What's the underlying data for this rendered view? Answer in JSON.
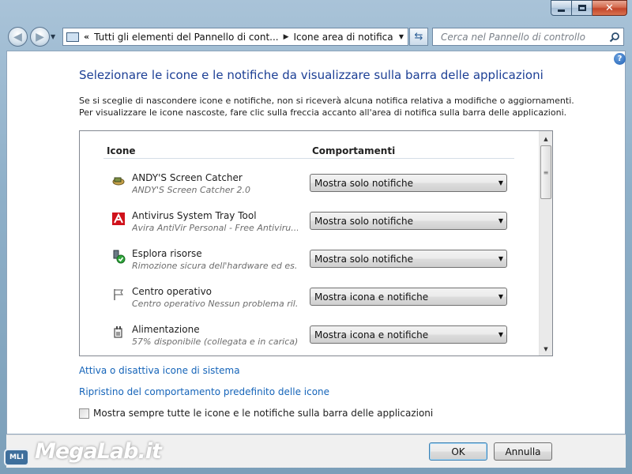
{
  "window": {
    "controls": {
      "minimize_icon": "minimize-icon",
      "maximize_icon": "maximize-icon",
      "close_icon": "close-icon"
    }
  },
  "navbar": {
    "breadcrumb_parent": "Tutti gli elementi del Pannello di cont...",
    "breadcrumb_current": "Icone area di notifica",
    "search_placeholder": "Cerca nel Pannello di controllo"
  },
  "main": {
    "title": "Selezionare le icone e le notifiche da visualizzare sulla barra delle applicazioni",
    "description_line1": "Se si sceglie di nascondere icone e notifiche, non si riceverà alcuna notifica relativa a modifiche o aggiornamenti.",
    "description_line2": "Per visualizzare le icone nascoste, fare clic sulla freccia accanto all'area di notifica sulla barra delle applicazioni.",
    "col_icons": "Icone",
    "col_behaviors": "Comportamenti",
    "rows": [
      {
        "name": "ANDY'S Screen Catcher",
        "sub": "ANDY'S Screen Catcher 2.0",
        "behavior": "Mostra solo notifiche",
        "icon": "screen-catcher-icon"
      },
      {
        "name": "Antivirus System Tray Tool",
        "sub": "Avira AntiVir Personal - Free Antiviru...",
        "behavior": "Mostra solo notifiche",
        "icon": "avira-icon"
      },
      {
        "name": "Esplora risorse",
        "sub": "Rimozione sicura dell'hardware ed es...",
        "behavior": "Mostra solo notifiche",
        "icon": "safe-remove-hardware-icon"
      },
      {
        "name": "Centro operativo",
        "sub": "Centro operativo  Nessun problema ril...",
        "behavior": "Mostra icona e notifiche",
        "icon": "action-center-flag-icon"
      },
      {
        "name": "Alimentazione",
        "sub": "57% disponibile (collegata e in carica)",
        "behavior": "Mostra icona e notifiche",
        "icon": "power-plug-icon"
      }
    ],
    "link_system_icons": "Attiva o disattiva icone di sistema",
    "link_restore": "Ripristino del comportamento predefinito delle icone",
    "checkbox_label": "Mostra sempre tutte le icone e le notifiche sulla barra delle applicazioni",
    "checkbox_checked": false
  },
  "buttons": {
    "ok": "OK",
    "cancel": "Annulla"
  },
  "watermark": {
    "text": "MegaLab.it",
    "badge": "MLI"
  },
  "colors": {
    "title": "#1c3f95",
    "link": "#1564b9",
    "frame": "#8fb0c9"
  }
}
